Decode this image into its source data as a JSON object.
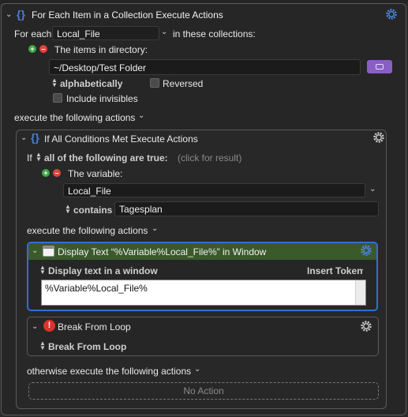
{
  "outer": {
    "title": "For Each Item in a Collection Execute Actions",
    "for_each_label": "For each",
    "variable_value": "Local_File",
    "in_collections_label": "in these collections:",
    "items_in_directory_label": "The items in directory:",
    "directory_path": "~/Desktop/Test Folder",
    "sort_label": "alphabetically",
    "reversed_label": "Reversed",
    "include_invisibles_label": "Include invisibles",
    "execute_label": "execute the following actions"
  },
  "inner": {
    "title": "If All Conditions Met Execute Actions",
    "if_label": "If",
    "condition_mode": "all of the following are true:",
    "click_for_result": "(click for result)",
    "variable_label": "The variable:",
    "variable_name": "Local_File",
    "operator": "contains",
    "compare_value": "Tagesplan",
    "execute_label": "execute the following actions",
    "otherwise_label": "otherwise execute the following actions",
    "no_action_label": "No Action"
  },
  "display_action": {
    "title": "Display Text “%Variable%Local_File%” in Window",
    "mode_label": "Display text in a window",
    "insert_token_label": "Insert Token",
    "text_value": "%Variable%Local_File%"
  },
  "break_action": {
    "title": "Break From Loop",
    "mode_label": "Break From Loop"
  },
  "colors": {
    "highlight_action_bg": "#3a5a2c",
    "highlight_border": "#2f6fd6",
    "accent_blue": "#2f6fd6",
    "purple_button": "#8a5fc4"
  }
}
